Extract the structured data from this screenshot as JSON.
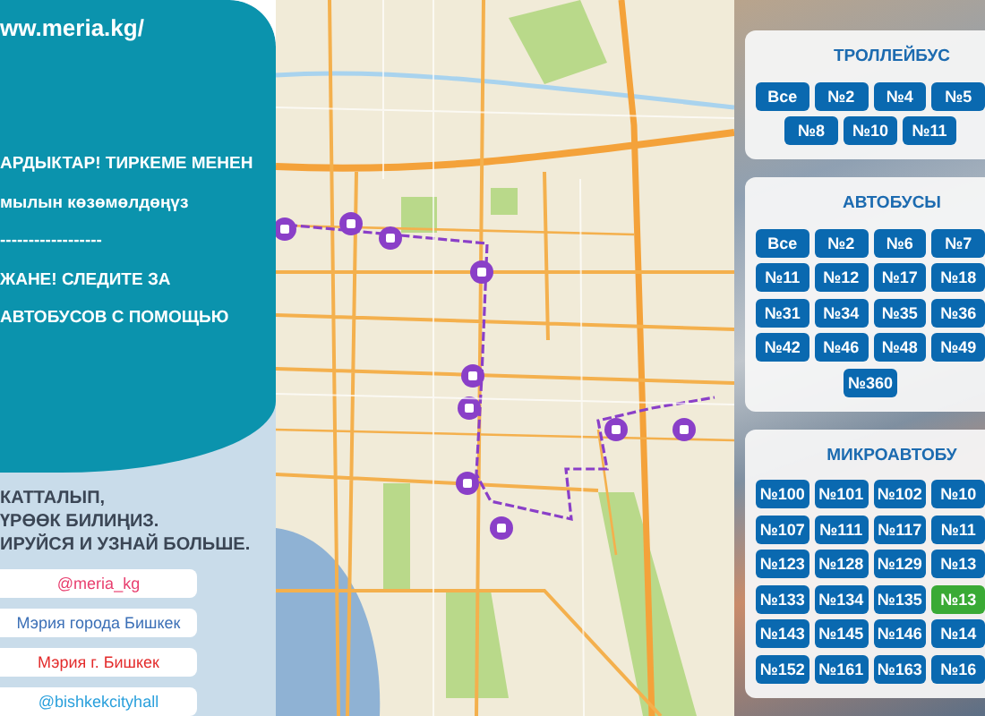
{
  "left_panel": {
    "url": "ww.meria.kg/",
    "lines_top": [
      "АРДЫКТАР! ТИРКЕМЕ МЕНЕН",
      "мылын көзөмөлдөңүз",
      "------------------",
      "ЖАНЕ! СЛЕДИТЕ ЗА",
      "АВТОБУСОВ С ПОМОЩЬЮ"
    ],
    "lines_bottom": [
      "КАТТАЛЫП,",
      "ҮРӨӨК БИЛИҢИЗ.",
      "ИРУЙСЯ И УЗНАЙ БОЛЬШЕ."
    ],
    "social_links": [
      {
        "label": "@meria_kg",
        "color": "#e83e6e"
      },
      {
        "label": "Мэрия города Бишкек",
        "color": "#3b6fb6"
      },
      {
        "label": "Мэрия г. Бишкек",
        "color": "#e32b2b"
      },
      {
        "label": "@bishkekcityhall",
        "color": "#2aa0dc"
      }
    ]
  },
  "route_groups": [
    {
      "title": "ТРОЛЛЕЙБУС",
      "rows": [
        [
          {
            "label": "Все",
            "selected": false
          },
          {
            "label": "№2",
            "selected": false
          },
          {
            "label": "№4",
            "selected": false
          },
          {
            "label": "№5",
            "selected": false
          }
        ],
        [
          {
            "label": "№8",
            "selected": false
          },
          {
            "label": "№10",
            "selected": false
          },
          {
            "label": "№11",
            "selected": false
          }
        ]
      ]
    },
    {
      "title": "АВТОБУСЫ",
      "rows": [
        [
          {
            "label": "Все",
            "selected": false
          },
          {
            "label": "№2",
            "selected": false
          },
          {
            "label": "№6",
            "selected": false
          },
          {
            "label": "№7",
            "selected": false
          }
        ],
        [
          {
            "label": "№11",
            "selected": false
          },
          {
            "label": "№12",
            "selected": false
          },
          {
            "label": "№17",
            "selected": false
          },
          {
            "label": "№18",
            "selected": false
          }
        ],
        [
          {
            "label": "№31",
            "selected": false
          },
          {
            "label": "№34",
            "selected": false
          },
          {
            "label": "№35",
            "selected": false
          },
          {
            "label": "№36",
            "selected": false
          }
        ],
        [
          {
            "label": "№42",
            "selected": false
          },
          {
            "label": "№46",
            "selected": false
          },
          {
            "label": "№48",
            "selected": false
          },
          {
            "label": "№49",
            "selected": false
          }
        ],
        [
          {
            "label": "№360",
            "selected": false
          }
        ]
      ]
    },
    {
      "title": "МИКРОАВТОБУ",
      "rows": [
        [
          {
            "label": "№100",
            "selected": false
          },
          {
            "label": "№101",
            "selected": false
          },
          {
            "label": "№102",
            "selected": false
          },
          {
            "label": "№10",
            "selected": false
          }
        ],
        [
          {
            "label": "№107",
            "selected": false
          },
          {
            "label": "№111",
            "selected": false
          },
          {
            "label": "№117",
            "selected": false
          },
          {
            "label": "№11",
            "selected": false
          }
        ],
        [
          {
            "label": "№123",
            "selected": false
          },
          {
            "label": "№128",
            "selected": false
          },
          {
            "label": "№129",
            "selected": false
          },
          {
            "label": "№13",
            "selected": false
          }
        ],
        [
          {
            "label": "№133",
            "selected": false
          },
          {
            "label": "№134",
            "selected": false
          },
          {
            "label": "№135",
            "selected": false
          },
          {
            "label": "№13",
            "selected": true
          }
        ],
        [
          {
            "label": "№143",
            "selected": false
          },
          {
            "label": "№145",
            "selected": false
          },
          {
            "label": "№146",
            "selected": false
          },
          {
            "label": "№14",
            "selected": false
          }
        ],
        [
          {
            "label": "№152",
            "selected": false
          },
          {
            "label": "№161",
            "selected": false
          },
          {
            "label": "№163",
            "selected": false
          },
          {
            "label": "№16",
            "selected": false
          }
        ]
      ]
    }
  ]
}
